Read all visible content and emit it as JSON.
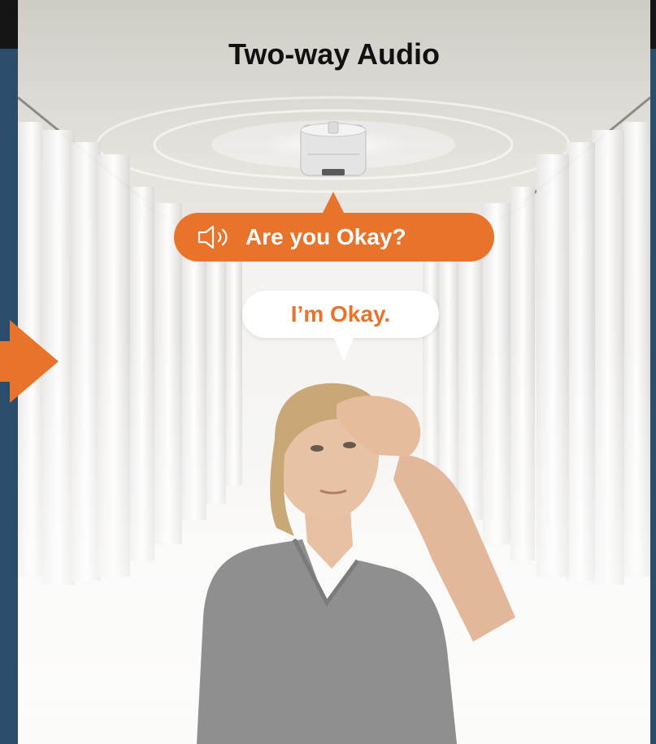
{
  "title": "Two-way Audio",
  "bubbles": {
    "question": "Are you Okay?",
    "answer": "I’m Okay."
  },
  "icons": {
    "speaker": "speaker-icon",
    "arrow": "right-arrow-icon"
  },
  "colors": {
    "accent": "#e8732a",
    "panel": "#2c4d69"
  }
}
